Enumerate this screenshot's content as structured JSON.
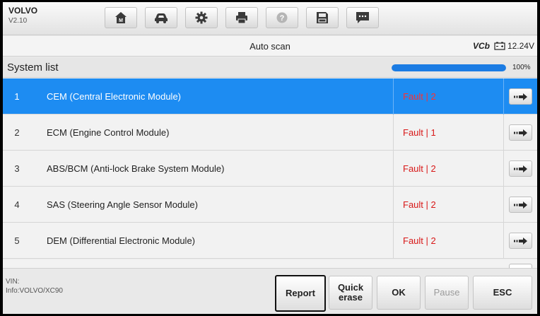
{
  "brand": {
    "make": "VOLVO",
    "version": "V2.10"
  },
  "toolbar": {
    "icons": [
      "home-icon",
      "car-icon",
      "gear-icon",
      "print-icon",
      "help-icon",
      "save-icon",
      "message-icon"
    ]
  },
  "scanbar": {
    "title": "Auto scan",
    "vci_label": "VCb",
    "voltage": "12.24V"
  },
  "system_list": {
    "title": "System list",
    "progress_percent": 100,
    "progress_label": "100%",
    "rows": [
      {
        "num": "1",
        "name": "CEM (Central Electronic Module)",
        "status": "Fault | 2",
        "selected": true
      },
      {
        "num": "2",
        "name": "ECM (Engine Control Module)",
        "status": "Fault | 1",
        "selected": false
      },
      {
        "num": "3",
        "name": "ABS/BCM (Anti-lock Brake System Module)",
        "status": "Fault | 2",
        "selected": false
      },
      {
        "num": "4",
        "name": "SAS (Steering Angle Sensor Module)",
        "status": "Fault | 2",
        "selected": false
      },
      {
        "num": "5",
        "name": "DEM (Differential Electronic Module)",
        "status": "Fault | 2",
        "selected": false
      }
    ]
  },
  "footer": {
    "vin_label": "VIN:",
    "info": "Info:VOLVO/XC90",
    "buttons": {
      "report": "Report",
      "quick_erase_1": "Quick",
      "quick_erase_2": "erase",
      "ok": "OK",
      "pause": "Pause",
      "esc": "ESC"
    }
  },
  "colors": {
    "accent": "#1d8cf2",
    "fault": "#d81818",
    "progress": "#1a7be3"
  }
}
